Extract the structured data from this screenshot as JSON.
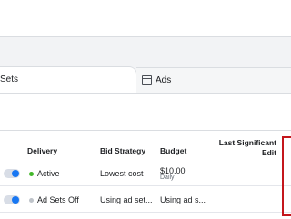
{
  "tabs": {
    "adsets_label": "Sets",
    "ads_label": "Ads"
  },
  "table": {
    "headers": {
      "delivery": "Delivery",
      "bid_strategy": "Bid Strategy",
      "budget": "Budget",
      "last_significant_edit": "Last Significant Edit"
    },
    "rows": [
      {
        "delivery": "Active",
        "bid_strategy": "Lowest cost",
        "budget": "$10.00",
        "budget_sub": "Daily"
      },
      {
        "delivery": "Ad Sets Off",
        "bid_strategy": "Using ad set...",
        "budget": "Using ad s..."
      }
    ]
  },
  "colors": {
    "accent": "#1877f2",
    "active": "#42b72a",
    "off": "#bec3c9",
    "highlight": "#c4161c"
  }
}
